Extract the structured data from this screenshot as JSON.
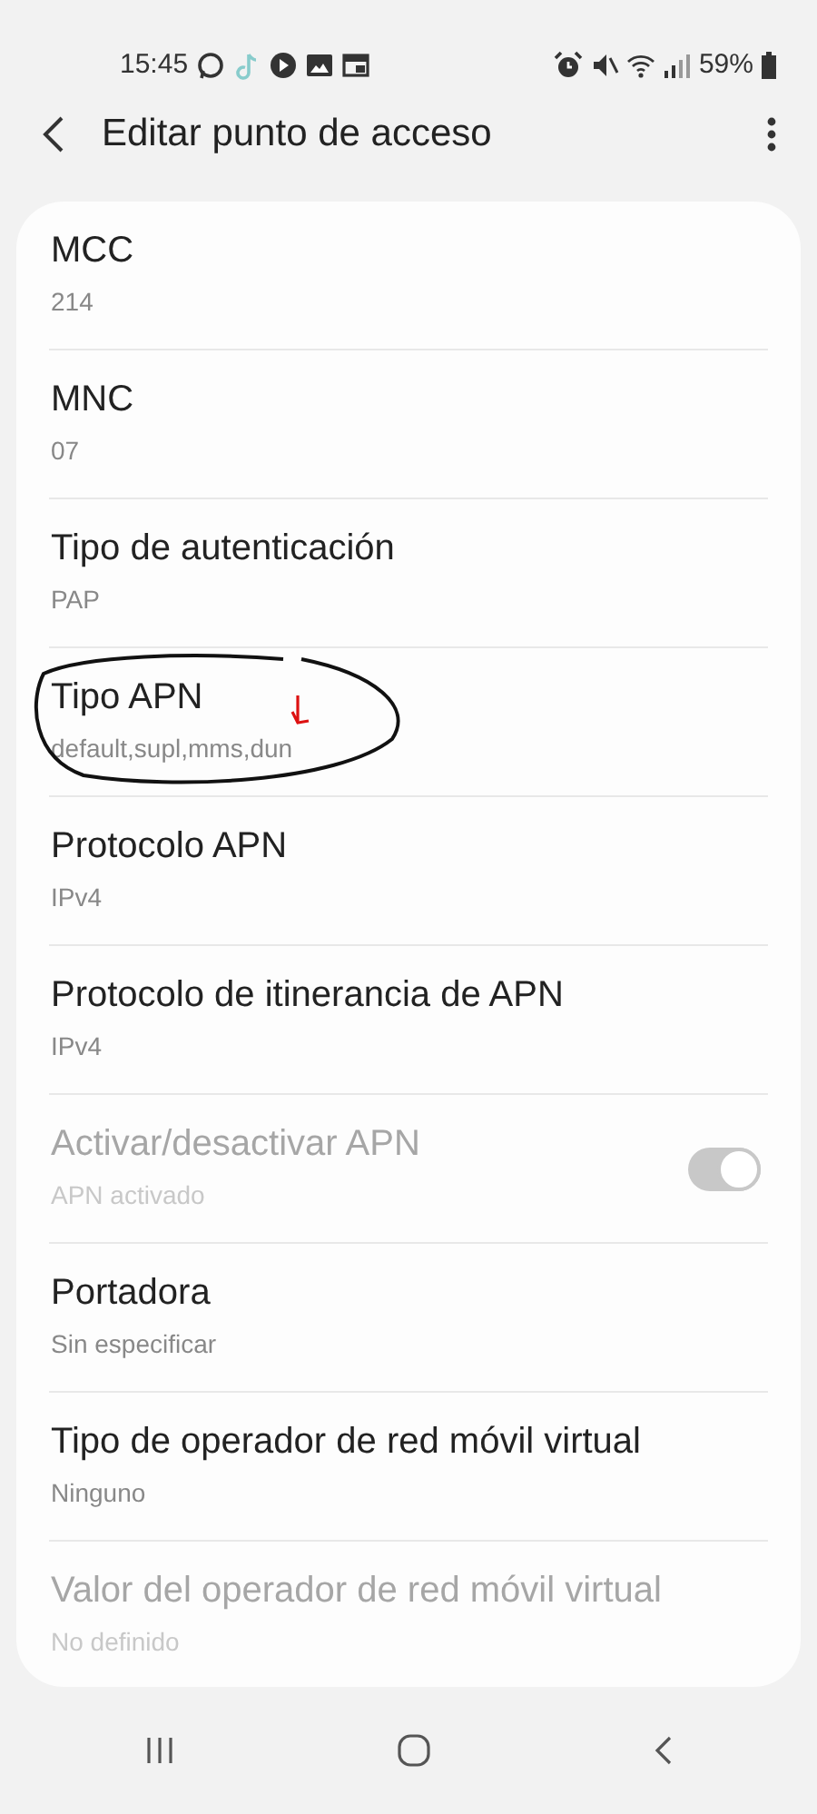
{
  "status_bar": {
    "time": "15:45",
    "battery": "59%"
  },
  "app_bar": {
    "title": "Editar punto de acceso"
  },
  "settings": [
    {
      "kind": "text",
      "title": "MCC",
      "value": "214",
      "disabled": false
    },
    {
      "kind": "text",
      "title": "MNC",
      "value": "07",
      "disabled": false
    },
    {
      "kind": "text",
      "title": "Tipo de autenticación",
      "value": "PAP",
      "disabled": false
    },
    {
      "kind": "text",
      "title": "Tipo APN",
      "value": "default,supl,mms,dun",
      "disabled": false,
      "circled": true
    },
    {
      "kind": "text",
      "title": "Protocolo APN",
      "value": "IPv4",
      "disabled": false
    },
    {
      "kind": "text",
      "title": "Protocolo de itinerancia de APN",
      "value": "IPv4",
      "disabled": false
    },
    {
      "kind": "switch",
      "title": "Activar/desactivar APN",
      "value": "APN activado",
      "disabled": true,
      "on": true
    },
    {
      "kind": "text",
      "title": "Portadora",
      "value": "Sin especificar",
      "disabled": false
    },
    {
      "kind": "text",
      "title": "Tipo de operador de red móvil virtual",
      "value": "Ninguno",
      "disabled": false
    },
    {
      "kind": "text",
      "title": "Valor del operador de red móvil virtual",
      "value": "No definido",
      "disabled": true
    }
  ]
}
